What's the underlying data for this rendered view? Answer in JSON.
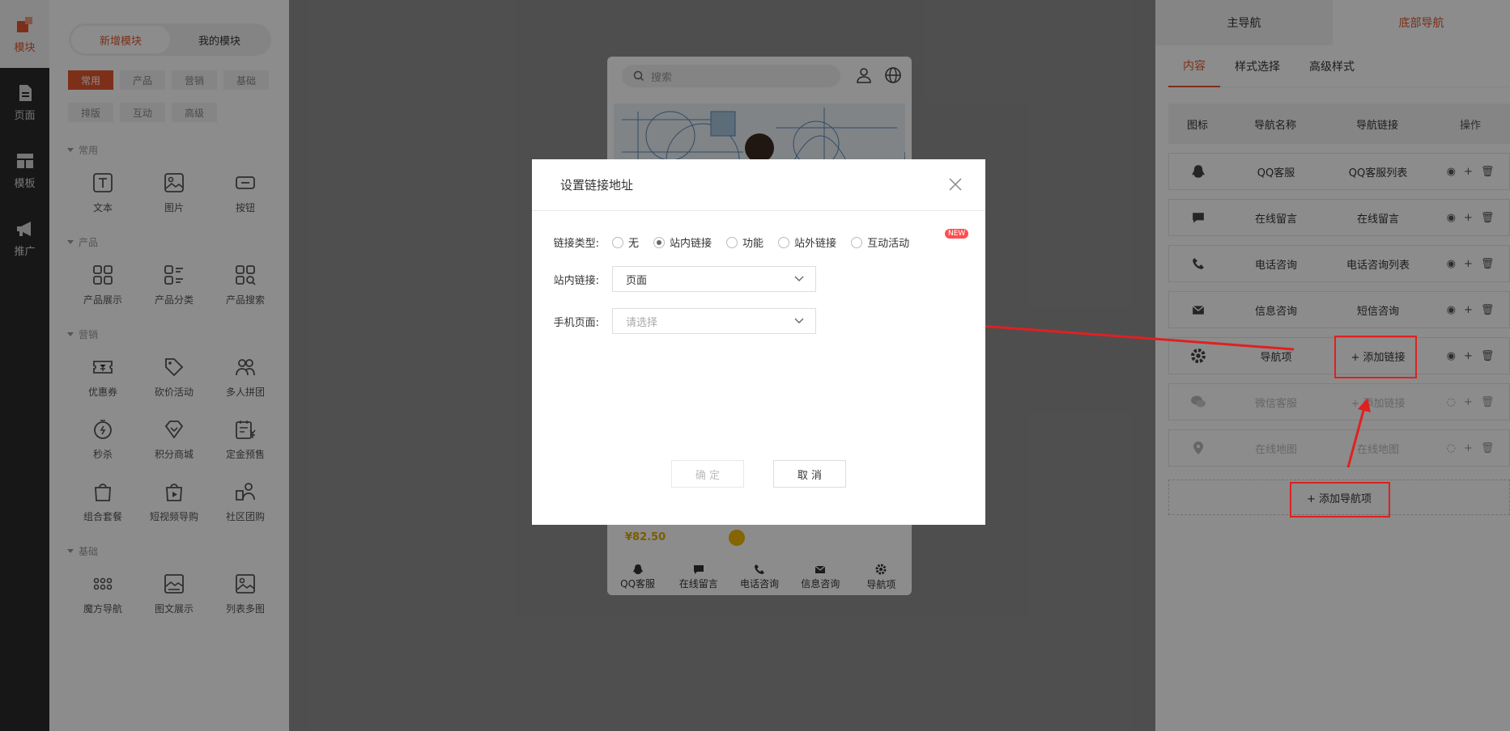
{
  "rail": [
    {
      "label": "模块",
      "icon": "module-icon",
      "active": true
    },
    {
      "label": "页面",
      "icon": "page-icon"
    },
    {
      "label": "模板",
      "icon": "template-icon"
    },
    {
      "label": "推广",
      "icon": "megaphone-icon"
    }
  ],
  "module_panel": {
    "seg": [
      "新增模块",
      "我的模块"
    ],
    "tags": [
      "常用",
      "产品",
      "营销",
      "基础",
      "排版",
      "互动",
      "高级"
    ],
    "sections": [
      {
        "title": "常用",
        "items": [
          "文本",
          "图片",
          "按钮"
        ]
      },
      {
        "title": "产品",
        "items": [
          "产品展示",
          "产品分类",
          "产品搜索"
        ]
      },
      {
        "title": "营销",
        "items": [
          "优惠券",
          "砍价活动",
          "多人拼团",
          "秒杀",
          "积分商城",
          "定金预售",
          "组合套餐",
          "短视频导购",
          "社区团购"
        ]
      },
      {
        "title": "基础",
        "items": [
          "魔方导航",
          "图文展示",
          "列表多图"
        ]
      }
    ]
  },
  "phone": {
    "search_placeholder": "搜索",
    "price": "¥82.50",
    "nav": [
      "QQ客服",
      "在线留言",
      "电话咨询",
      "信息咨询",
      "导航项"
    ]
  },
  "right_panel": {
    "tabs": [
      "主导航",
      "底部导航"
    ],
    "subtabs": [
      "内容",
      "样式选择",
      "高级样式"
    ],
    "columns": [
      "图标",
      "导航名称",
      "导航链接",
      "操作"
    ],
    "rows": [
      {
        "icon": "qq-icon",
        "name": "QQ客服",
        "link": "QQ客服列表"
      },
      {
        "icon": "message-icon",
        "name": "在线留言",
        "link": "在线留言"
      },
      {
        "icon": "phone-icon",
        "name": "电话咨询",
        "link": "电话咨询列表"
      },
      {
        "icon": "mail-icon",
        "name": "信息咨询",
        "link": "短信咨询"
      },
      {
        "icon": "gear-icon",
        "name": "导航项",
        "link": "+ 添加链接"
      },
      {
        "icon": "wechat-icon",
        "name": "微信客服",
        "link": "+ 添加链接",
        "dim": true
      },
      {
        "icon": "location-icon",
        "name": "在线地图",
        "link": "在线地图",
        "dim": true
      }
    ],
    "add_nav": "+ 添加导航项"
  },
  "dialog": {
    "title": "设置链接地址",
    "link_type_label": "链接类型:",
    "link_types": [
      "无",
      "站内链接",
      "功能",
      "站外链接",
      "互动活动"
    ],
    "selected_type": "站内链接",
    "new_badge": "NEW",
    "internal_label": "站内链接:",
    "internal_value": "页面",
    "mobile_label": "手机页面:",
    "mobile_placeholder": "请选择",
    "confirm": "确 定",
    "cancel": "取 消"
  },
  "colors": {
    "accent": "#e4572e",
    "annotation": "#e02020"
  }
}
